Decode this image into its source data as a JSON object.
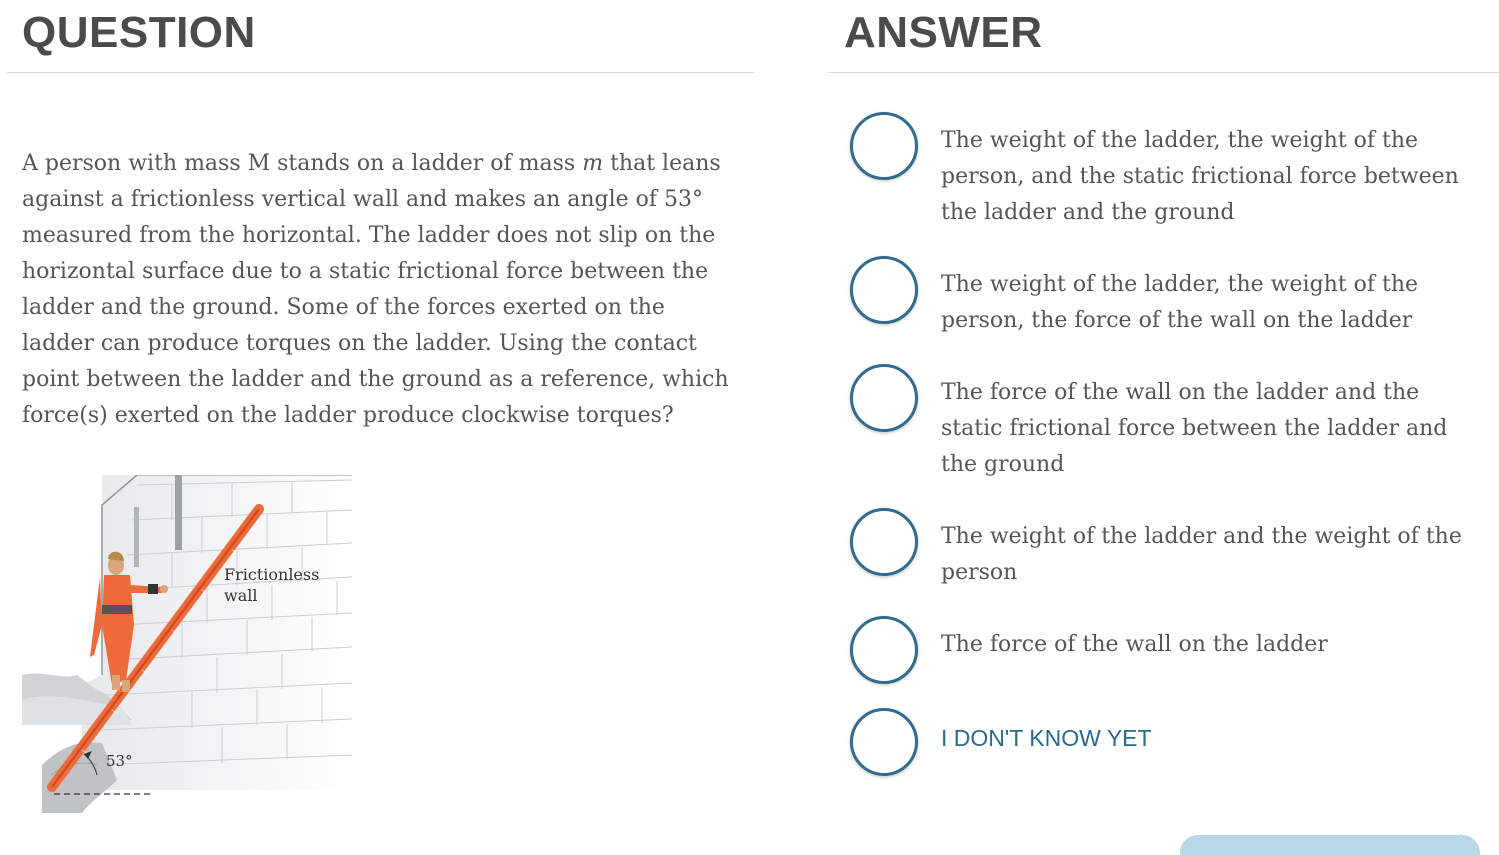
{
  "question": {
    "heading": "QUESTION",
    "text_part1": "A person with mass M stands on a ladder of mass ",
    "text_math": "m",
    "text_part2": " that leans against a frictionless vertical wall and makes an angle of 53° measured from the horizontal. The ladder does not slip on the horizontal surface due to a static frictional force between the ladder and the ground. Some of the forces exerted on the ladder can produce torques on the ladder. Using the contact point between the ladder and the ground as a reference, which force(s) exerted on the ladder produce clockwise torques?",
    "figure": {
      "wall_label_line1": "Frictionless",
      "wall_label_line2": "wall",
      "angle_label": "53°"
    }
  },
  "answer": {
    "heading": "ANSWER",
    "options": [
      {
        "label": "The weight of the ladder, the weight of the person, and the static frictional force between the ladder and the ground",
        "selected": false
      },
      {
        "label": "The weight of the ladder, the weight of the person, the force of the wall on the ladder",
        "selected": false
      },
      {
        "label": "The force of the wall on the ladder and the static frictional force between the ladder and the ground",
        "selected": false
      },
      {
        "label": "The weight of the ladder and the weight of the person",
        "selected": false
      },
      {
        "label": "The force of the wall on the ladder",
        "selected": false
      },
      {
        "label": "I DON'T KNOW YET",
        "selected": false
      }
    ]
  },
  "colors": {
    "radio_border": "#2f6c8f",
    "idk_text": "#2a6a8e",
    "ladder": "#ef6a3a",
    "button": "#b9d7e6"
  }
}
